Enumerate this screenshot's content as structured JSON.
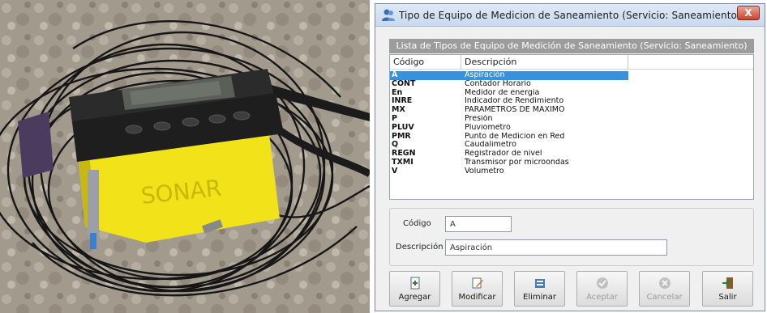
{
  "window": {
    "title": "Tipo de Equipo de Medicion de Saneamiento (Servicio: Saneamiento)",
    "close_glyph": "X"
  },
  "list": {
    "header": "Lista de Tipos de Equipo de Medición de Saneamiento (Servicio: Saneamiento)",
    "columns": [
      "Código",
      "Descripción"
    ],
    "rows": [
      {
        "codigo": "A",
        "descripcion": "Aspiración",
        "selected": true
      },
      {
        "codigo": "CONT",
        "descripcion": "Contador Horario"
      },
      {
        "codigo": "En",
        "descripcion": "Medidor de energia"
      },
      {
        "codigo": "INRE",
        "descripcion": "Indicador de Rendimiento"
      },
      {
        "codigo": "MX",
        "descripcion": "PARAMETROS DE MAXIMO"
      },
      {
        "codigo": "P",
        "descripcion": "Presión"
      },
      {
        "codigo": "PLUV",
        "descripcion": "Pluviometro"
      },
      {
        "codigo": "PMR",
        "descripcion": "Punto de Medicion en Red"
      },
      {
        "codigo": "Q",
        "descripcion": "Caudalimetro"
      },
      {
        "codigo": "REGN",
        "descripcion": "Registrador de nivel"
      },
      {
        "codigo": "TXMI",
        "descripcion": "Transmisor por microondas"
      },
      {
        "codigo": "V",
        "descripcion": "Volumetro"
      }
    ]
  },
  "form": {
    "codigo_label": "Código",
    "codigo_value": "A",
    "descripcion_label": "Descripción",
    "descripcion_value": "Aspiración"
  },
  "toolbar": {
    "agregar": "Agregar",
    "modificar": "Modificar",
    "eliminar": "Eliminar",
    "aceptar": "Aceptar",
    "cancelar": "Cancelar",
    "salir": "Salir"
  },
  "photo": {
    "device_brand": "SONAR",
    "icon": "photo-of-flow-meter"
  },
  "colors": {
    "selection": "#3b90d9",
    "header_bar": "#9c9c9c",
    "device_yellow": "#f2e21a"
  }
}
